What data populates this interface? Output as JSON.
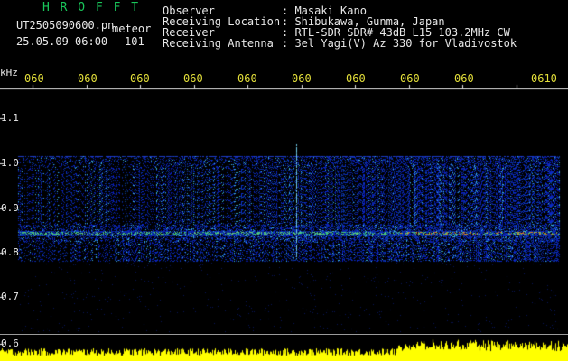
{
  "header": {
    "station_name": "H R O F F T",
    "filename": "UT2505090600.pn",
    "mode_label": "meteor",
    "datetime": "25.05.09 06:00",
    "count": "101",
    "fields": [
      {
        "label": "Observer",
        "value": ": Masaki Kano"
      },
      {
        "label": "Receiving Location",
        "value": ": Shibukawa, Gunma, Japan"
      },
      {
        "label": "Receiver",
        "value": ": RTL-SDR SDR# 43dB L15 103.2MHz CW"
      },
      {
        "label": "Receiving Antenna",
        "value": ": 3el Yagi(V) Az 330 for Vladivostok"
      }
    ]
  },
  "axes": {
    "y_unit": "kHz",
    "y_ticks": [
      "1.1",
      "1.0",
      "0.9",
      "0.8",
      "0.7",
      "0.6"
    ],
    "x_ticks": [
      "060",
      "060",
      "060",
      "060",
      "060",
      "060",
      "060",
      "060",
      "060",
      "0610"
    ]
  },
  "colors": {
    "background": "#000000",
    "station_green": "#19c65a",
    "time_tick_yellow": "#e3df3a",
    "bar_yellow": "#ffff00"
  }
}
